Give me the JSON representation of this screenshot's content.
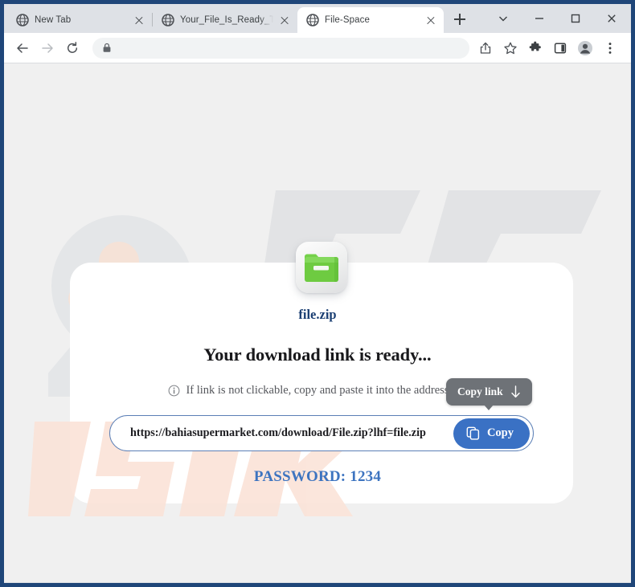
{
  "window": {
    "border_color": "#1f4679",
    "controls": {
      "tab_search_label": "tab-search",
      "minimize_label": "minimize",
      "maximize_label": "maximize",
      "close_label": "close"
    }
  },
  "tabs": [
    {
      "title": "New Tab",
      "active": false,
      "favicon": "globe-icon"
    },
    {
      "title": "Your_File_Is_Ready_To_Downl",
      "active": false,
      "favicon": "globe-icon"
    },
    {
      "title": "File-Space",
      "active": true,
      "favicon": "globe-icon"
    }
  ],
  "new_tab_button_label": "+",
  "toolbar": {
    "back_label": "Back",
    "forward_label": "Forward",
    "reload_label": "Reload",
    "omnibox_value": "",
    "omnibox_placeholder": "",
    "lock_icon": "lock-icon",
    "share_label": "Share",
    "bookmark_label": "Bookmark this tab",
    "extensions_label": "Extensions",
    "side_panel_label": "Side panel",
    "profile_label": "Profile",
    "menu_label": "Customize and control Google Chrome"
  },
  "page": {
    "file_name": "file.zip",
    "file_icon": "green-zip-folder-icon",
    "headline": "Your download link is ready...",
    "info_icon": "info-circle-icon",
    "subtext": "If link is not clickable, copy and paste it into the address bar",
    "url_value": "https://bahiasupermarket.com/download/File.zip?lhf=file.zip",
    "copy_button_label": "Copy",
    "copy_button_icon": "copy-icon",
    "copy_button_color": "#3a71c4",
    "tooltip_label": "Copy link",
    "tooltip_arrow": "↓",
    "tooltip_color": "#6e7277",
    "password_line": "PASSWORD: 1234",
    "password_color": "#3d74c0",
    "file_name_color": "#1b3f73",
    "background_color": "#f0f0f0",
    "card_color": "#ffffff",
    "watermark_pc": "PC",
    "watermark_risk": "RISK"
  }
}
